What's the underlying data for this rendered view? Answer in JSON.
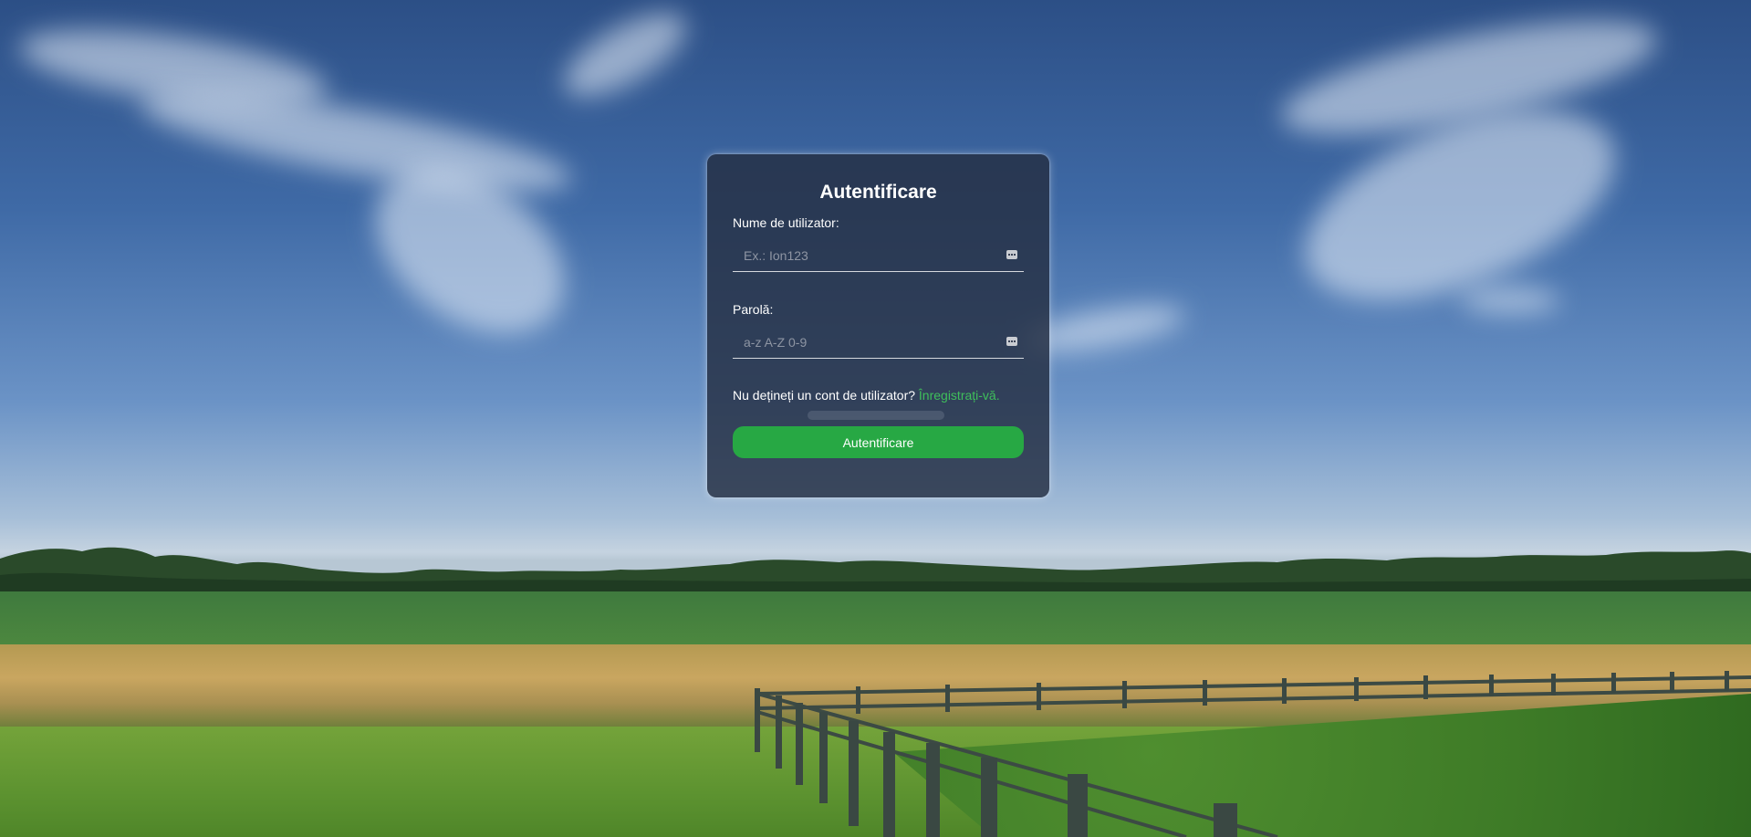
{
  "login": {
    "title": "Autentificare",
    "username_label": "Nume de utilizator:",
    "username_placeholder": "Ex.: Ion123",
    "password_label": "Parolă:",
    "password_placeholder": "a-z A-Z 0-9",
    "register_prompt": "Nu dețineți un cont de utilizator?",
    "register_link": "Înregistrați-vă.",
    "submit_label": "Autentificare"
  },
  "colors": {
    "accent_green": "#27a844",
    "link_green": "#3fbf5b",
    "card_background": "#242e42"
  },
  "icons": {
    "username_field_icon": "keyboard-icon",
    "password_field_icon": "keyboard-icon"
  }
}
